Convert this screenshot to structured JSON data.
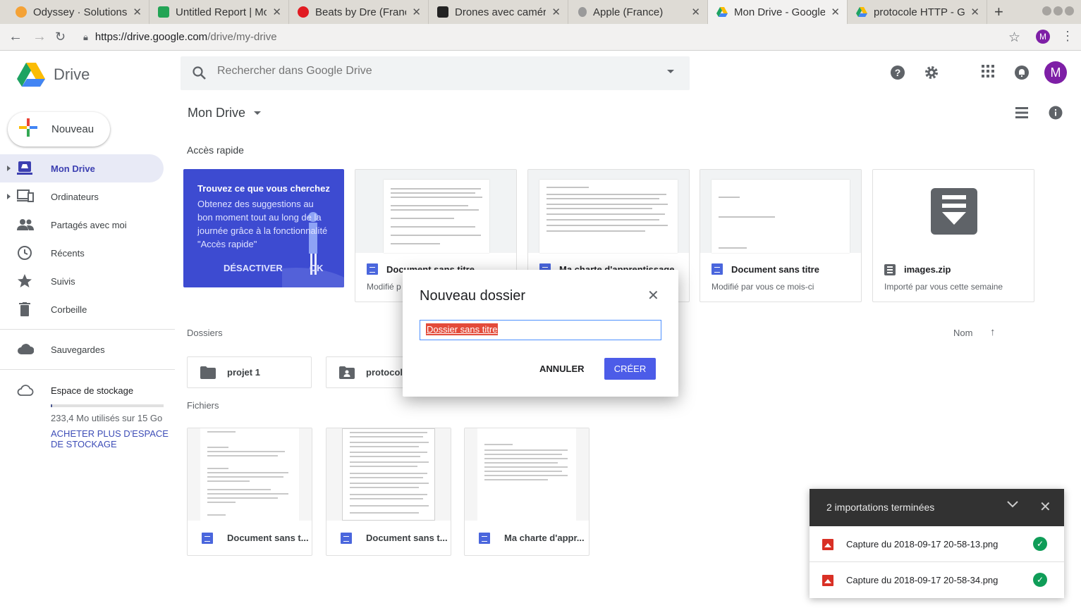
{
  "browser": {
    "tabs": [
      {
        "title": "Odyssey · Solutions",
        "favicon_color": "#f4a236"
      },
      {
        "title": "Untitled Report | Mc",
        "favicon_color": "#23a455"
      },
      {
        "title": "Beats by Dre (Franc",
        "favicon_color": "#e11b22"
      },
      {
        "title": "Drones avec caméra",
        "favicon_color": "#222222"
      },
      {
        "title": "Apple (France)",
        "favicon_color": "#9a9a9a"
      },
      {
        "title": "Mon Drive - Google",
        "favicon_color": "#1ea362"
      },
      {
        "title": "protocole HTTP - Go",
        "favicon_color": "#1ea362"
      }
    ],
    "active_tab": 5,
    "url_host": "https://drive.google.com",
    "url_path": "/drive/my-drive",
    "profile_initial": "M"
  },
  "header": {
    "app_name": "Drive",
    "search_placeholder": "Rechercher dans Google Drive",
    "avatar_initial": "M",
    "accent": "#7e1fa6"
  },
  "sidebar": {
    "new_label": "Nouveau",
    "items": [
      {
        "label": "Mon Drive"
      },
      {
        "label": "Ordinateurs"
      },
      {
        "label": "Partagés avec moi"
      },
      {
        "label": "Récents"
      },
      {
        "label": "Suivis"
      },
      {
        "label": "Corbeille"
      },
      {
        "label": "Sauvegardes"
      }
    ],
    "storage_title": "Espace de stockage",
    "storage_used": "233,4 Mo utilisés sur 15 Go",
    "storage_fraction": 0.015,
    "storage_buy": "ACHETER PLUS D'ESPACE DE STOCKAGE"
  },
  "main": {
    "title": "Mon Drive",
    "quick_access_label": "Accès rapide",
    "promo": {
      "title": "Trouvez ce que vous cherchez",
      "body": "Obtenez des suggestions au bon moment tout au long de la journée grâce à la fonctionnalité \"Accès rapide\"",
      "disable": "DÉSACTIVER",
      "ok": "OK"
    },
    "quick_items": [
      {
        "title": "Document sans titre",
        "sub": "Modifié p"
      },
      {
        "title": "Ma charte d'apprentissage",
        "sub": ""
      },
      {
        "title": "Document sans titre",
        "sub": "Modifié par vous ce mois-ci"
      },
      {
        "title": "images.zip",
        "sub": "Importé par vous cette semaine"
      }
    ],
    "folders_label": "Dossiers",
    "sort_label": "Nom",
    "folders": [
      {
        "name": "projet 1"
      },
      {
        "name": "protocole"
      }
    ],
    "files_label": "Fichiers",
    "files": [
      {
        "name": "Document sans t..."
      },
      {
        "name": "Document sans t..."
      },
      {
        "name": "Ma charte d'appr..."
      }
    ]
  },
  "dialog": {
    "title": "Nouveau dossier",
    "input_value": "Dossier sans titre",
    "cancel_label": "ANNULER",
    "create_label": "CRÉER"
  },
  "uploads": {
    "title": "2 importations terminées",
    "items": [
      {
        "name": "Capture du 2018-09-17 20-58-13.png"
      },
      {
        "name": "Capture du 2018-09-17 20-58-34.png"
      }
    ]
  }
}
